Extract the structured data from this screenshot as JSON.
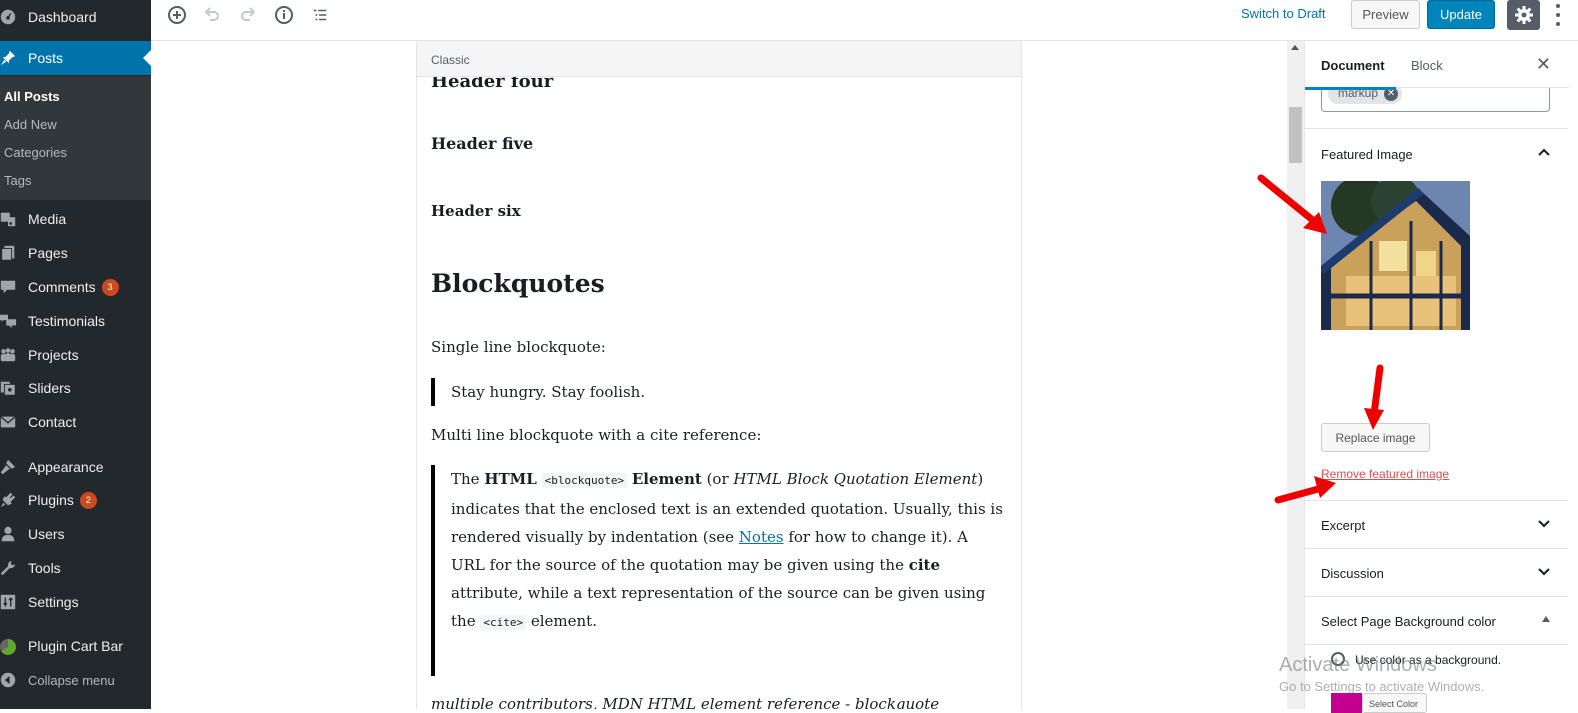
{
  "sidebar": {
    "items": [
      {
        "label": "Dashboard",
        "icon": "dashboard-icon"
      },
      {
        "label": "Posts",
        "icon": "pin-icon",
        "active": true
      },
      {
        "label": "Media",
        "icon": "media-icon"
      },
      {
        "label": "Pages",
        "icon": "pages-icon"
      },
      {
        "label": "Comments",
        "icon": "comment-icon",
        "badge": "3"
      },
      {
        "label": "Testimonials",
        "icon": "testimonials-icon"
      },
      {
        "label": "Projects",
        "icon": "projects-icon"
      },
      {
        "label": "Sliders",
        "icon": "sliders-icon"
      },
      {
        "label": "Contact",
        "icon": "mail-icon"
      },
      {
        "label": "Appearance",
        "icon": "brush-icon"
      },
      {
        "label": "Plugins",
        "icon": "plugin-icon",
        "badge": "2"
      },
      {
        "label": "Users",
        "icon": "user-icon"
      },
      {
        "label": "Tools",
        "icon": "wrench-icon"
      },
      {
        "label": "Settings",
        "icon": "settings-icon"
      },
      {
        "label": "Plugin Cart Bar",
        "icon": "cart-bar-icon"
      },
      {
        "label": "Collapse menu",
        "icon": "collapse-icon"
      }
    ],
    "submenu": [
      "All Posts",
      "Add New",
      "Categories",
      "Tags"
    ]
  },
  "toolbar": {
    "switch_draft": "Switch to Draft",
    "preview": "Preview",
    "update": "Update"
  },
  "editor": {
    "block_label": "Classic",
    "h4": "Header four",
    "h5": "Header five",
    "h6": "Header six",
    "h2": "Blockquotes",
    "single_intro": "Single line blockquote:",
    "single_quote": "Stay hungry. Stay foolish.",
    "multi_intro": "Multi line blockquote with a cite reference:",
    "quote": {
      "p1": "The ",
      "b1": "HTML",
      "code1": "<blockquote>",
      "b2": "Element",
      "p2": " (or ",
      "i1": "HTML Block Quotation Element",
      "p3": ") indicates that the enclosed text is an extended quotation. Usually, this is rendered visually by indentation (see ",
      "link": "Notes",
      "p4": " for how to change it). A URL for the source of the quotation may be given using the ",
      "b3": "cite",
      "p5": " attribute, while a text representation of the source can be given using the ",
      "code2": "<cite>",
      "p6": " element."
    },
    "footer_text": "multiple contributors, MDN HTML element reference - blockquote"
  },
  "panel": {
    "tabs": [
      "Document",
      "Block"
    ],
    "tag": "markup",
    "featured_title": "Featured Image",
    "replace": "Replace image",
    "remove": "Remove featured image",
    "excerpt": "Excerpt",
    "discussion": "Discussion",
    "bg_title": "Select Page Background color",
    "use_color": "Use color as a background.",
    "select_color": "Select Color",
    "swatch_color": "#c3008f"
  },
  "watermark": {
    "line1": "Activate Windows",
    "line2": "Go to Settings to activate Windows."
  }
}
